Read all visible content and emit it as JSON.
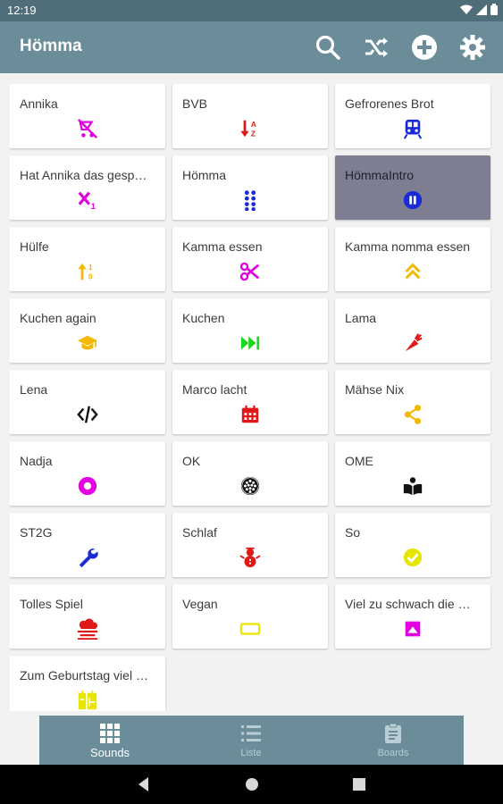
{
  "status": {
    "time": "12:19"
  },
  "appbar": {
    "title": "Hömma",
    "actions": [
      {
        "name": "search-icon"
      },
      {
        "name": "shuffle-icon"
      },
      {
        "name": "add-circle-icon"
      },
      {
        "name": "settings-icon"
      }
    ]
  },
  "sounds": [
    {
      "label": "Annika",
      "icon": "no-stroller-icon",
      "color": "#e100e1"
    },
    {
      "label": "BVB",
      "icon": "sort-az-icon",
      "color": "#e01818"
    },
    {
      "label": "Gefrorenes Brot",
      "icon": "train-icon",
      "color": "#1a2bd6"
    },
    {
      "label": "Hat Annika das gesp…",
      "icon": "subscript-icon",
      "color": "#e100e1"
    },
    {
      "label": "Hömma",
      "icon": "drag-dots-icon",
      "color": "#1a2bd6"
    },
    {
      "label": "HömmaIntro",
      "icon": "pause-circle-icon",
      "color": "#1a2bd6",
      "selected": true
    },
    {
      "label": "Hülfe",
      "icon": "sort-numeric-icon",
      "color": "#f5b800"
    },
    {
      "label": "Kamma essen",
      "icon": "scissors-icon",
      "color": "#e100e1"
    },
    {
      "label": "Kamma nomma essen",
      "icon": "chevron-double-up-icon",
      "color": "#f5b800"
    },
    {
      "label": "Kuchen again",
      "icon": "graduation-cap-icon",
      "color": "#f5b800"
    },
    {
      "label": "Kuchen",
      "icon": "fast-forward-icon",
      "color": "#1ed61e"
    },
    {
      "label": "Lama",
      "icon": "carrot-icon",
      "color": "#e01818"
    },
    {
      "label": "Lena",
      "icon": "code-icon",
      "color": "#111111"
    },
    {
      "label": "Marco lacht",
      "icon": "calendar-icon",
      "color": "#e01818"
    },
    {
      "label": "Mähse Nix",
      "icon": "share-icon",
      "color": "#f5b800"
    },
    {
      "label": "Nadja",
      "icon": "record-icon",
      "color": "#e100e1"
    },
    {
      "label": "OK",
      "icon": "soccer-ball-icon",
      "color": "#111111"
    },
    {
      "label": "OME",
      "icon": "book-reader-icon",
      "color": "#111111"
    },
    {
      "label": "ST2G",
      "icon": "wrench-icon",
      "color": "#1a2bd6"
    },
    {
      "label": "Schlaf",
      "icon": "snowman-icon",
      "color": "#e01818"
    },
    {
      "label": "So",
      "icon": "check-circle-icon",
      "color": "#e6e600"
    },
    {
      "label": "Tolles Spiel",
      "icon": "weather-fog-icon",
      "color": "#e01818"
    },
    {
      "label": "Vegan",
      "icon": "battery-outline-icon",
      "color": "#e6e600"
    },
    {
      "label": "Viel zu schwach die …",
      "icon": "image-square-icon",
      "color": "#e100e1"
    },
    {
      "label": "Zum Geburtstag viel …",
      "icon": "cake-sign-icon",
      "color": "#e6e600"
    }
  ],
  "bottom_nav": [
    {
      "label": "Sounds",
      "icon": "grid-icon",
      "active": true
    },
    {
      "label": "Liste",
      "icon": "list-icon",
      "active": false
    },
    {
      "label": "Boards",
      "icon": "clipboard-icon",
      "active": false
    }
  ],
  "system_nav": [
    {
      "name": "back-icon"
    },
    {
      "name": "home-icon"
    },
    {
      "name": "recents-icon"
    }
  ]
}
